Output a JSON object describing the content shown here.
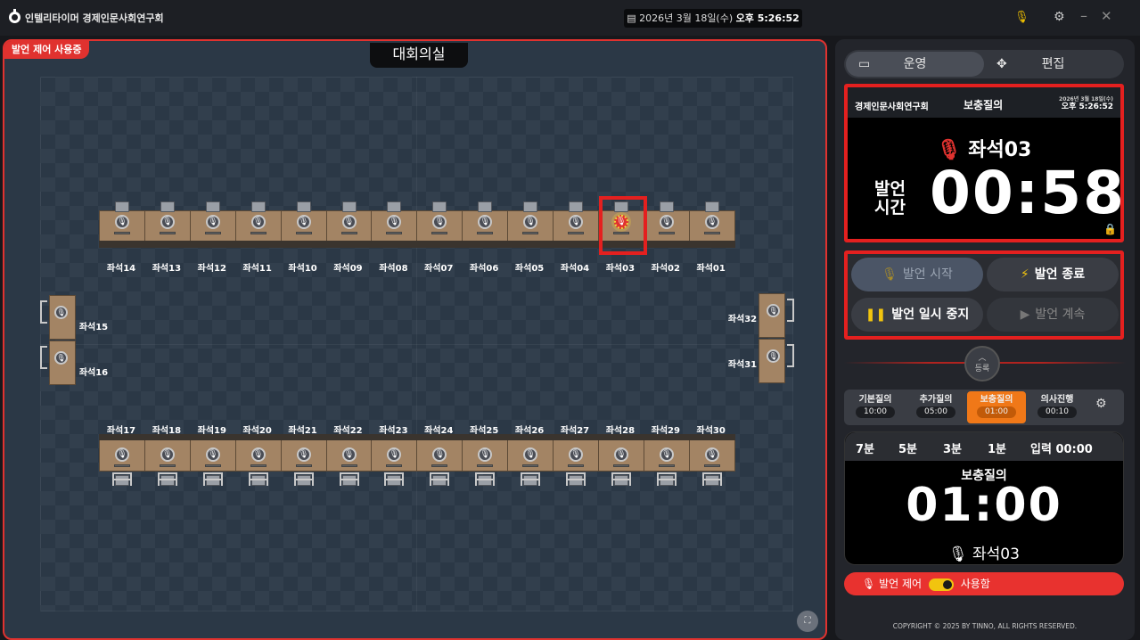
{
  "app": {
    "title": "인텔리타이머 경제인문사회연구회"
  },
  "header": {
    "date": "2026년 3월 18일(수)",
    "time": "오후 5:26:52"
  },
  "stage": {
    "in_use_badge": "발언 제어 사용중",
    "room": "대회의실"
  },
  "seats": {
    "top_row": [
      "좌석14",
      "좌석13",
      "좌석12",
      "좌석11",
      "좌석10",
      "좌석09",
      "좌석08",
      "좌석07",
      "좌석06",
      "좌석05",
      "좌석04",
      "좌석03",
      "좌석02",
      "좌석01"
    ],
    "bottom_row": [
      "좌석17",
      "좌석18",
      "좌석19",
      "좌석20",
      "좌석21",
      "좌석22",
      "좌석23",
      "좌석24",
      "좌석25",
      "좌석26",
      "좌석27",
      "좌석28",
      "좌석29",
      "좌석30"
    ],
    "left": [
      "좌석15",
      "좌석16"
    ],
    "right": [
      "좌석32",
      "좌석31"
    ],
    "active_seat": "좌석03"
  },
  "mode": {
    "run_label": "운영",
    "edit_label": "편집"
  },
  "speaker": {
    "org": "경제인문사회연구회",
    "kind": "보충질의",
    "date_small": "2026년 3월 18일(수)",
    "time_small": "오후 5:26:52",
    "seat": "좌석03",
    "time_label_1": "발언",
    "time_label_2": "시간",
    "timer": "00:58"
  },
  "controls": {
    "start": "발언 시작",
    "end": "발언 종료",
    "pause": "발언 일시 중지",
    "resume": "발언 계속"
  },
  "register": {
    "label": "등록"
  },
  "question_tabs": [
    {
      "label": "기본질의",
      "time": "10:00"
    },
    {
      "label": "추가질의",
      "time": "05:00"
    },
    {
      "label": "보충질의",
      "time": "01:00"
    },
    {
      "label": "의사진행",
      "time": "00:10"
    }
  ],
  "timer_panel": {
    "presets": [
      "7분",
      "5분",
      "3분",
      "1분",
      "입력 00:00"
    ],
    "kind": "보충질의",
    "time": "01:00",
    "seat": "좌석03"
  },
  "speech_control": {
    "label": "발언 제어",
    "state": "사용함"
  },
  "footer": {
    "copyright": "COPYRIGHT © 2025 BY TINNO, ALL RIGHTS RESERVED."
  },
  "colors": {
    "accent_red": "#e0322f",
    "highlight_orange": "#f07818",
    "mic_yellow": "#f1c40f"
  }
}
